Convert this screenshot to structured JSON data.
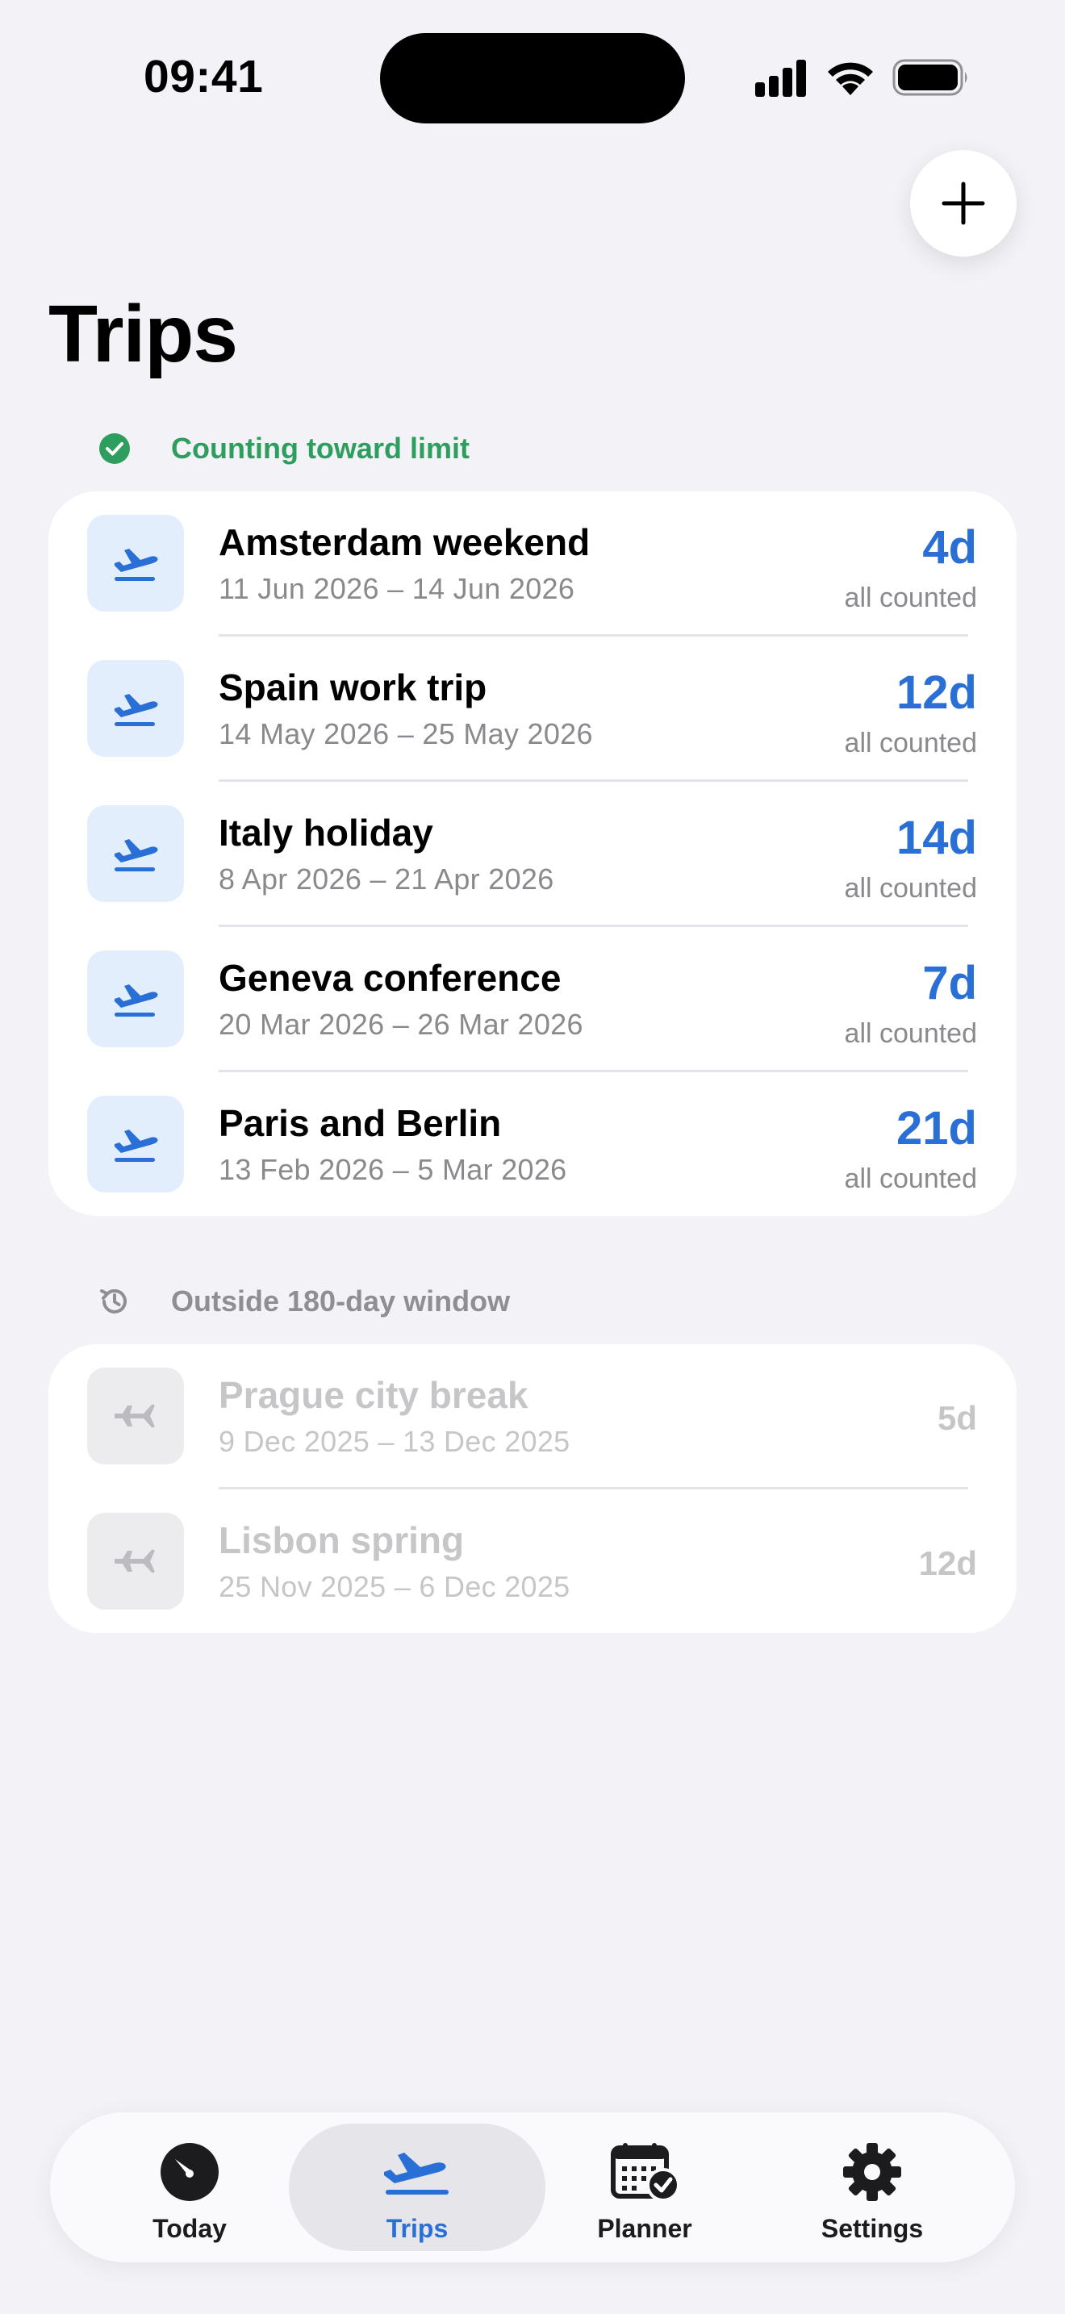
{
  "status_bar": {
    "time": "09:41"
  },
  "page": {
    "title": "Trips"
  },
  "sections": {
    "counting": {
      "label": "Counting toward limit"
    },
    "outside": {
      "label": "Outside 180-day window"
    }
  },
  "trips_counting": [
    {
      "name": "Amsterdam weekend",
      "dates": "11 Jun 2026 – 14 Jun 2026",
      "days": "4d",
      "sub": "all counted"
    },
    {
      "name": "Spain work trip",
      "dates": "14 May 2026 – 25 May 2026",
      "days": "12d",
      "sub": "all counted"
    },
    {
      "name": "Italy holiday",
      "dates": "8 Apr 2026 – 21 Apr 2026",
      "days": "14d",
      "sub": "all counted"
    },
    {
      "name": "Geneva conference",
      "dates": "20 Mar 2026 – 26 Mar 2026",
      "days": "7d",
      "sub": "all counted"
    },
    {
      "name": "Paris and Berlin",
      "dates": "13 Feb 2026 – 5 Mar 2026",
      "days": "21d",
      "sub": "all counted"
    }
  ],
  "trips_outside": [
    {
      "name": "Prague city break",
      "dates": "9 Dec 2025 – 13 Dec 2025",
      "days": "5d"
    },
    {
      "name": "Lisbon spring",
      "dates": "25 Nov 2025 – 6 Dec 2025",
      "days": "12d"
    }
  ],
  "tabbar": {
    "tabs": [
      {
        "label": "Today",
        "icon": "gauge-icon"
      },
      {
        "label": "Trips",
        "icon": "airplane-departure-icon",
        "selected": true
      },
      {
        "label": "Planner",
        "icon": "calendar-check-icon"
      },
      {
        "label": "Settings",
        "icon": "gear-icon"
      }
    ]
  },
  "colors": {
    "accent": "#2a6fd6",
    "counting_green": "#2e9e5e",
    "background": "#f2f2f7",
    "muted": "#8a8a8e"
  }
}
